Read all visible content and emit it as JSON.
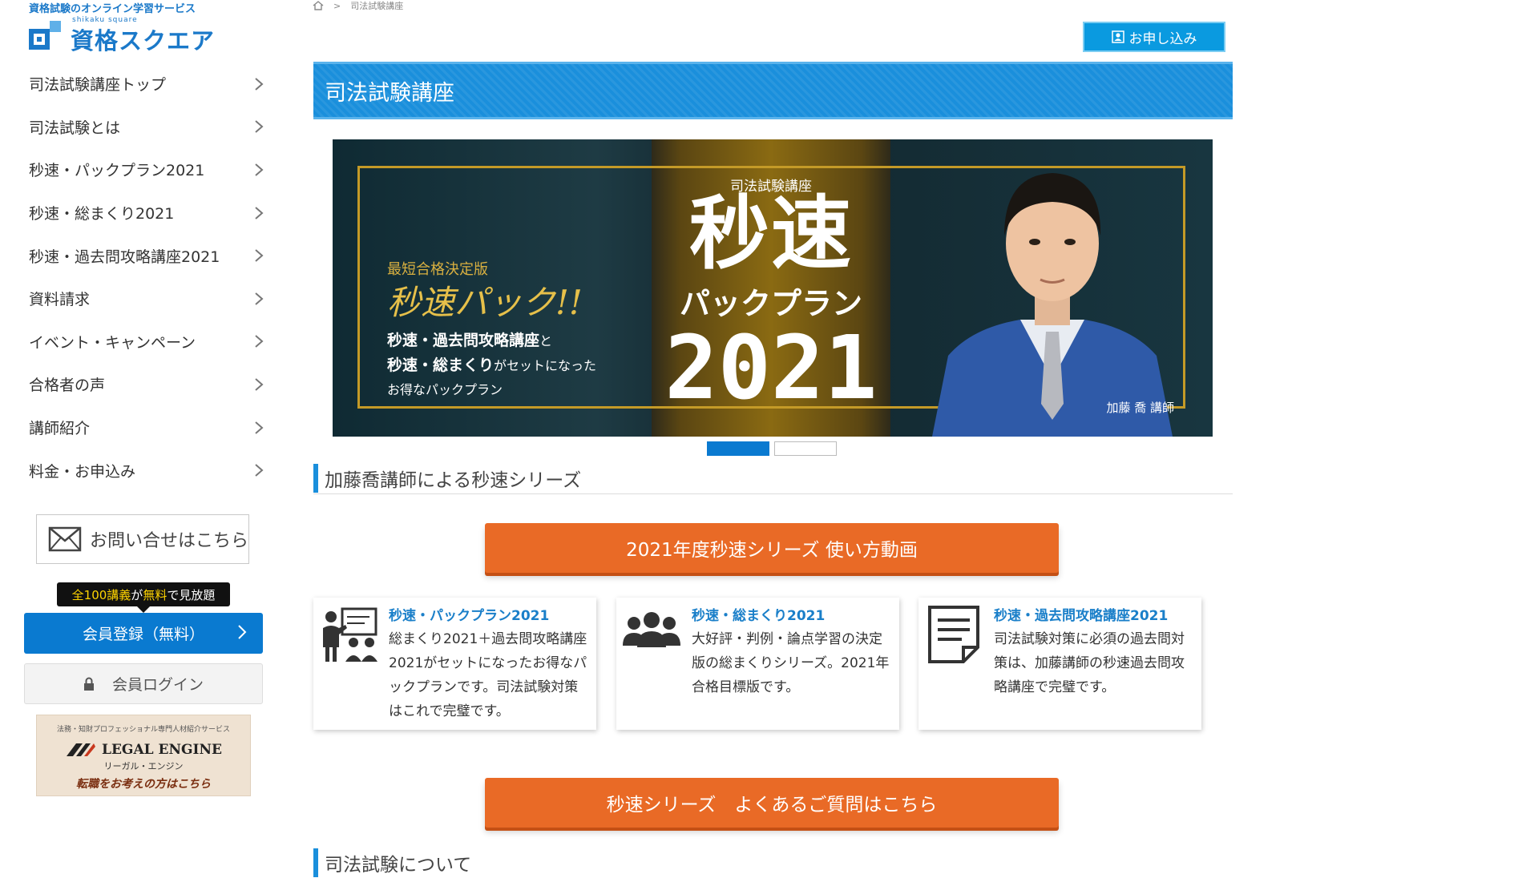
{
  "logo": {
    "tagline": "資格試験のオンライン学習サービス",
    "sub": "shikaku square",
    "name": "資格スクエア"
  },
  "sidebar": {
    "items": [
      {
        "label": "司法試験講座トップ"
      },
      {
        "label": "司法試験とは"
      },
      {
        "label": "秒速・パックプラン2021"
      },
      {
        "label": "秒速・総まくり2021"
      },
      {
        "label": "秒速・過去問攻略講座2021"
      },
      {
        "label": "資料請求"
      },
      {
        "label": "イベント・キャンペーン"
      },
      {
        "label": "合格者の声"
      },
      {
        "label": "講師紹介"
      },
      {
        "label": "料金・お申込み"
      }
    ],
    "contact_label": "お問い合せはこちら",
    "free_tip": {
      "highlight": "全100講義",
      "mid": "が",
      "highlight2": "無料",
      "rest": "で見放題"
    },
    "register_label": "会員登録（無料）",
    "login_label": "会員ログイン",
    "legal_engine": {
      "line1": "法務・知財プロフェッショナル専門人材紹介サービス",
      "brand": "LEGAL ENGINE",
      "kana": "リーガル・エンジン",
      "cta": "転職をお考えの方はこちら"
    }
  },
  "breadcrumb": {
    "sep": ">",
    "current": "司法試験講座"
  },
  "header": {
    "apply_label": "お申し込み"
  },
  "page_title": "司法試験講座",
  "banner": {
    "left_small": "最短合格決定版",
    "left_big": "秒速パック!!",
    "left_line1_a": "秒速・過去問攻略講座",
    "left_line1_b": "と",
    "left_line2_a": "秒速・総まくり",
    "left_line2_b": "がセットになった",
    "left_line3": "お得なパックプラン",
    "center_small": "司法試験講座",
    "center_big": "秒速",
    "center_mid": "パックプラン",
    "center_year": "2021",
    "caption": "加藤 喬 講師"
  },
  "slider": {
    "active_color": "#0a7ad0",
    "inactive_color": "#ffffff"
  },
  "section1_title": "加藤喬講師による秒速シリーズ",
  "video_button": "2021年度秒速シリーズ 使い方動画",
  "cards": [
    {
      "title": "秒速・パックプラン2021",
      "desc": "総まくり2021＋過去問攻略講座2021がセットになったお得なパックプランです。司法試験対策はこれで完璧です。",
      "icon": "teacher-board-icon"
    },
    {
      "title": "秒速・総まくり2021",
      "desc": "大好評・判例・論点学習の決定版の総まくりシリーズ。2021年合格目標版です。",
      "icon": "group-people-icon"
    },
    {
      "title": "秒速・過去問攻略講座2021",
      "desc": "司法試験対策に必須の過去問対策は、加藤講師の秒速過去問攻略講座で完璧です。",
      "icon": "document-icon"
    }
  ],
  "faq_button": "秒速シリーズ　よくあるご質問はこちら",
  "section2_title": "司法試験について",
  "colors": {
    "brand_blue": "#1a8fdc",
    "orange": "#e96a26",
    "link_blue": "#1a7fc9"
  }
}
